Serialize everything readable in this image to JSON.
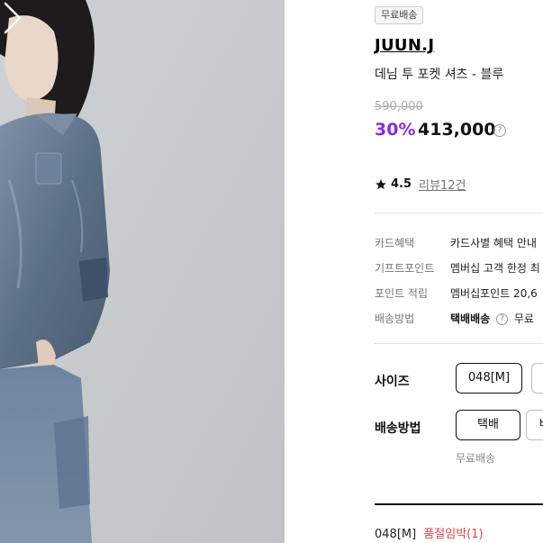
{
  "gallery": {
    "next_icon": "chevron-right-icon"
  },
  "product": {
    "badge": "무료배송",
    "brand": "JUUN.J",
    "name": "데님 투 포켓 셔츠 - 블루",
    "original_price": "590,000",
    "discount": "30%",
    "sale_price": "413,000",
    "help_glyph": "?"
  },
  "rating": {
    "icon": "star-icon",
    "value": "4.5",
    "review_link": "리뷰12건"
  },
  "benefits": [
    {
      "label": "카드혜택",
      "value": "카드사별 혜택 안내"
    },
    {
      "label": "기프트포인트",
      "value": "멤버십 고객 한정 최"
    },
    {
      "label": "포인트 적립",
      "value": "멤버십포인트 20,6"
    },
    {
      "label": "배송방법",
      "value_bold": "택배배송",
      "value_rest": "무료"
    }
  ],
  "options": {
    "size_label": "사이즈",
    "size_selected": "048[M]",
    "shipping_label": "배송방법",
    "shipping_selected": "택배",
    "shipping_other": "배",
    "shipping_note": "무료배송"
  },
  "selection": {
    "option": "048[M]",
    "status": "품절임박(1)"
  },
  "colors": {
    "discount": "#8a2be2",
    "soldout": "#e0474c",
    "photo_background": "#c9ccce",
    "denim": "#5b6f86"
  }
}
